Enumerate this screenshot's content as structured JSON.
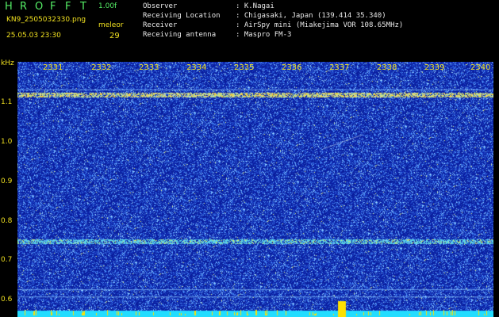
{
  "header": {
    "title_letters": [
      "H",
      "R",
      "O",
      "F",
      "F",
      "T"
    ],
    "version": "1.00f",
    "filename": "KN9_2505032330.png",
    "mode_label": "meleor",
    "count": "29",
    "datetime": "25.05.03 23:30",
    "info": [
      {
        "label": "Observer",
        "value": ": K.Nagai"
      },
      {
        "label": "Receiving Location",
        "value": ": Chigasaki, Japan (139.414 35.340)"
      },
      {
        "label": "Receiver",
        "value": ": AirSpy mini (Miakejima VOR 108.65MHz)"
      },
      {
        "label": "Receiving antenna",
        "value": ": Maspro FM-3"
      }
    ]
  },
  "axes": {
    "y_unit": "kHz",
    "y_ticks": [
      "1.1",
      "1.0",
      "0.9",
      "0.8",
      "0.7",
      "0.6"
    ],
    "x_ticks": [
      "2331",
      "2332",
      "2333",
      "2334",
      "2335",
      "2336",
      "2337",
      "2338",
      "2339",
      "2340"
    ]
  },
  "colors": {
    "background": "#0a1f9a",
    "noise": "#5aa0ff",
    "signal_hot": "#ffdd00",
    "base_strip": "#22ddff",
    "label": "#f0e020",
    "title": "#55ee66"
  }
}
